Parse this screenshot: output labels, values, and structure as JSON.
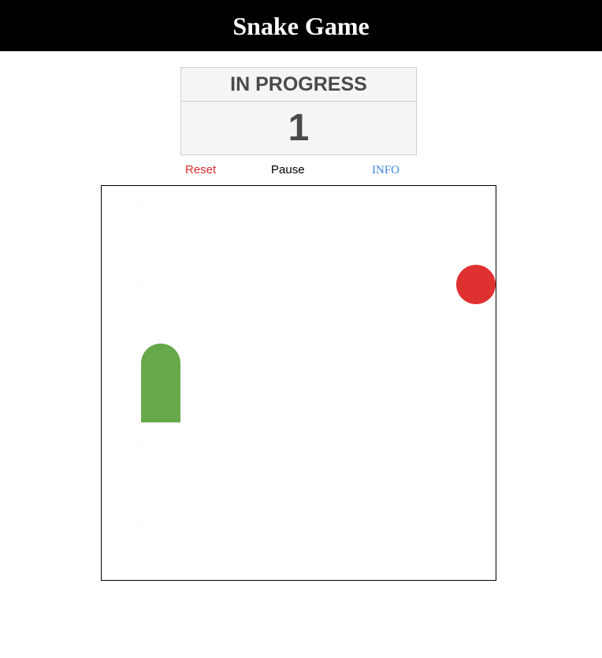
{
  "header": {
    "title": "Snake Game"
  },
  "game": {
    "status": "IN PROGRESS",
    "score": "1"
  },
  "controls": {
    "reset_label": "Reset",
    "pause_label": "Pause",
    "info_label": "INFO"
  },
  "colors": {
    "header_bg": "#000000",
    "snake": "#66a84a",
    "food": "#e03131",
    "reset": "#d32f2f",
    "info": "#3b82e6",
    "panel_text": "#4a4a4a"
  }
}
